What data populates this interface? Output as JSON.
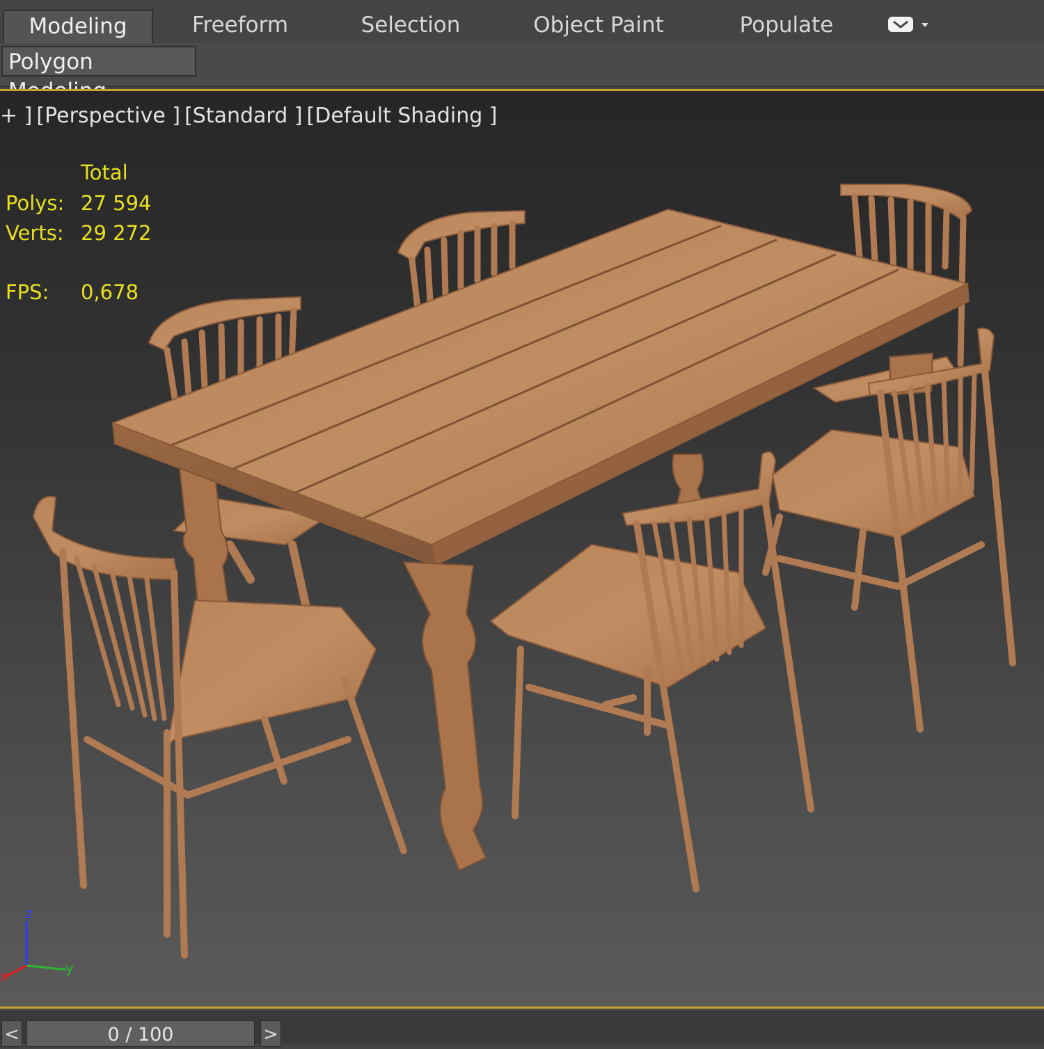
{
  "ribbon": {
    "tabs": [
      {
        "label": "Modeling",
        "active": true
      },
      {
        "label": "Freeform",
        "active": false
      },
      {
        "label": "Selection",
        "active": false
      },
      {
        "label": "Object Paint",
        "active": false
      },
      {
        "label": "Populate",
        "active": false
      }
    ],
    "extra_icon": "ribbon-options-icon",
    "subtab": "Polygon Modeling"
  },
  "viewport": {
    "labels": [
      "+ ]",
      "[Perspective ]",
      "[Standard ]",
      "[Default Shading ]"
    ],
    "stats": {
      "header": "Total",
      "polys_label": "Polys:",
      "polys_value": "27 594",
      "verts_label": "Verts:",
      "verts_value": "29 272",
      "fps_label": "FPS:",
      "fps_value": "0,678"
    },
    "axis": {
      "z": "z",
      "y": "y",
      "x": "x"
    },
    "colors": {
      "border": "#c8a32c",
      "stats": "#e8e020",
      "wood": "#b07a52"
    }
  },
  "timeline": {
    "prev": "<",
    "slider": "0 / 100",
    "next": ">"
  }
}
